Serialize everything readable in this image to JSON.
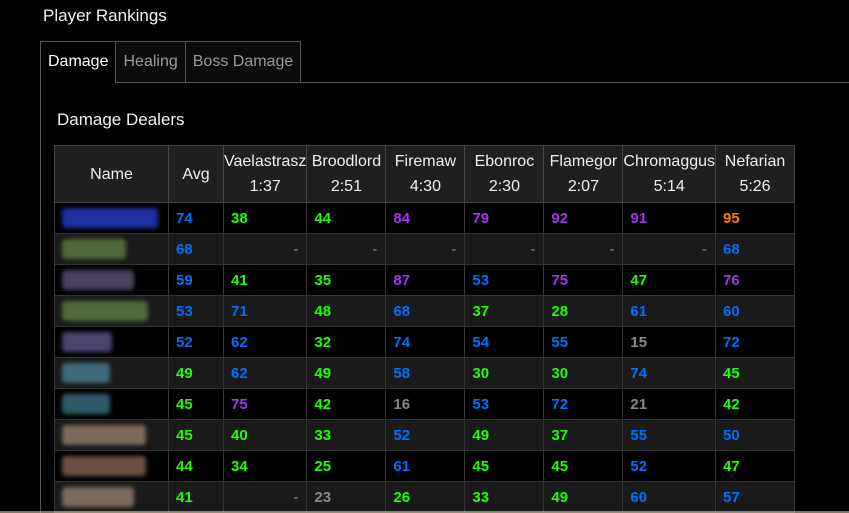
{
  "page_title": "Player Rankings",
  "tabs": [
    {
      "label": "Damage",
      "active": true
    },
    {
      "label": "Healing",
      "active": false
    },
    {
      "label": "Boss Damage",
      "active": false
    }
  ],
  "section_title": "Damage Dealers",
  "columns": {
    "name": "Name",
    "avg": "Avg",
    "bosses": [
      {
        "name": "Vaelastrasz",
        "time": "1:37"
      },
      {
        "name": "Broodlord",
        "time": "2:51"
      },
      {
        "name": "Firemaw",
        "time": "4:30"
      },
      {
        "name": "Ebonroc",
        "time": "2:30"
      },
      {
        "name": "Flamegor",
        "time": "2:07"
      },
      {
        "name": "Chromaggus",
        "time": "5:14"
      },
      {
        "name": "Nefarian",
        "time": "5:26"
      }
    ]
  },
  "colors": {
    "orange": "#ff8000",
    "purple": "#a335ee",
    "blue": "#0070ff",
    "green": "#1eff00",
    "gray": "#888888"
  },
  "rows": [
    {
      "name_blur": "#1e2fa0",
      "avg": "74",
      "scores": [
        "38",
        "44",
        "84",
        "79",
        "92",
        "91",
        "95"
      ]
    },
    {
      "name_blur": "#4e6a3a",
      "avg": "68",
      "scores": [
        "-",
        "-",
        "-",
        "-",
        "-",
        "-",
        "68"
      ]
    },
    {
      "name_blur": "#4a4060",
      "avg": "59",
      "scores": [
        "41",
        "35",
        "87",
        "53",
        "75",
        "47",
        "76"
      ]
    },
    {
      "name_blur": "#4f6a3c",
      "avg": "53",
      "scores": [
        "71",
        "48",
        "68",
        "37",
        "28",
        "61",
        "60"
      ]
    },
    {
      "name_blur": "#4a4470",
      "avg": "52",
      "scores": [
        "62",
        "32",
        "74",
        "54",
        "55",
        "15",
        "72"
      ]
    },
    {
      "name_blur": "#3f6a7a",
      "avg": "49",
      "scores": [
        "62",
        "49",
        "58",
        "30",
        "30",
        "74",
        "45"
      ]
    },
    {
      "name_blur": "#2f5a68",
      "avg": "45",
      "scores": [
        "75",
        "42",
        "16",
        "53",
        "72",
        "21",
        "42"
      ]
    },
    {
      "name_blur": "#7a6a58",
      "avg": "45",
      "scores": [
        "40",
        "33",
        "52",
        "49",
        "37",
        "55",
        "50"
      ]
    },
    {
      "name_blur": "#6a5040",
      "avg": "44",
      "scores": [
        "34",
        "25",
        "61",
        "45",
        "45",
        "52",
        "47"
      ]
    },
    {
      "name_blur": "#7a6a60",
      "avg": "41",
      "scores": [
        "-",
        "23",
        "26",
        "33",
        "49",
        "60",
        "57"
      ]
    }
  ]
}
